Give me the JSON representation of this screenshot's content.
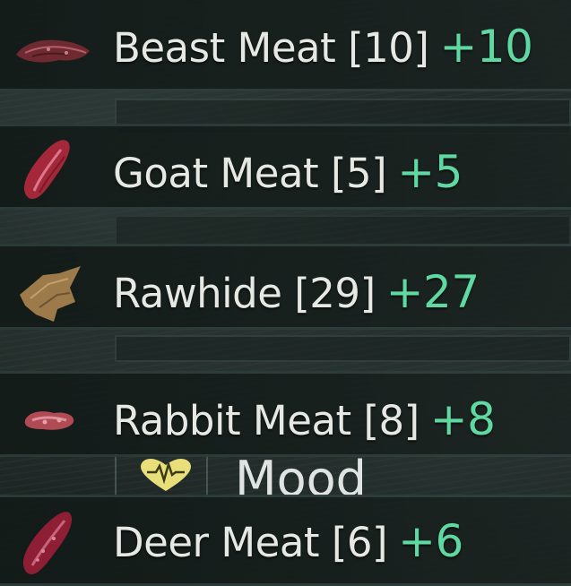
{
  "colors": {
    "item_name": "#e6e8e4",
    "gain": "#5fd9a1",
    "mood_heart": "#e9df7a",
    "background": "#1e2725"
  },
  "loot": [
    {
      "name": "Beast Meat",
      "count": "[10]",
      "gain": "+10",
      "icon": "beast-meat-icon"
    },
    {
      "name": "Goat Meat",
      "count": "[5]",
      "gain": "+5",
      "icon": "goat-meat-icon"
    },
    {
      "name": "Rawhide",
      "count": "[29]",
      "gain": "+27",
      "icon": "rawhide-icon"
    },
    {
      "name": "Rabbit Meat",
      "count": "[8]",
      "gain": "+8",
      "icon": "rabbit-meat-icon"
    },
    {
      "name": "Deer Meat",
      "count": "[6]",
      "gain": "+6",
      "icon": "deer-meat-icon"
    }
  ],
  "status": {
    "mood_label": "Mood",
    "mood_icon": "heart-pulse-icon"
  }
}
